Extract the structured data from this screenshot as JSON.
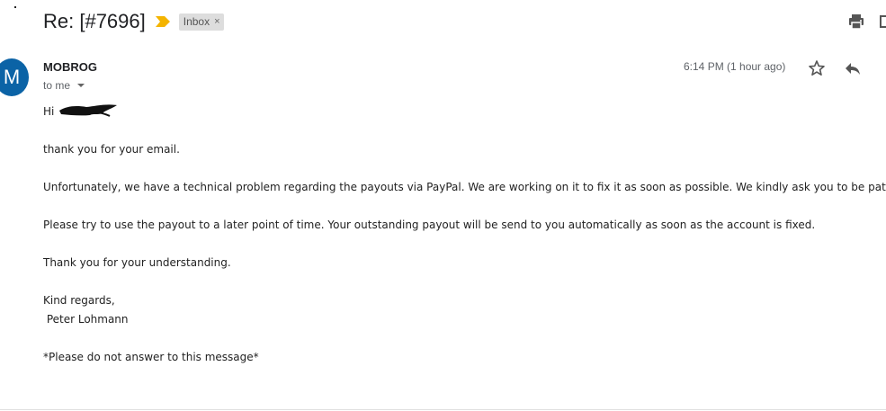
{
  "email": {
    "subject": "Re: [#7696]",
    "label": "Inbox",
    "label_remove": "×",
    "sender_initial": "M",
    "sender_name": "MOBROG",
    "recipient": "to me",
    "timestamp": "6:14 PM (1 hour ago)",
    "body": {
      "greeting": "Hi",
      "line1": "thank you for your email.",
      "line2": "Unfortunately, we have a technical problem regarding the payouts via PayPal. We are working on it to fix it as soon as possible. We kindly ask you to be patient.",
      "line3": "Please try to use the payout to a later point of time. Your outstanding payout will be send to you automatically as soon as the account is fixed.",
      "line4": "Thank you for your understanding.",
      "signoff": "Kind regards,",
      "signature": " Peter Lohmann",
      "footer": "*Please do not answer to this message*"
    }
  },
  "colors": {
    "avatar": "#0b63a6",
    "importance": "#f4b400",
    "label_bg": "#dddddd"
  },
  "icons": [
    "importance-marker-icon",
    "print-icon",
    "new-window-icon",
    "star-icon",
    "reply-icon",
    "chevron-down-icon"
  ]
}
